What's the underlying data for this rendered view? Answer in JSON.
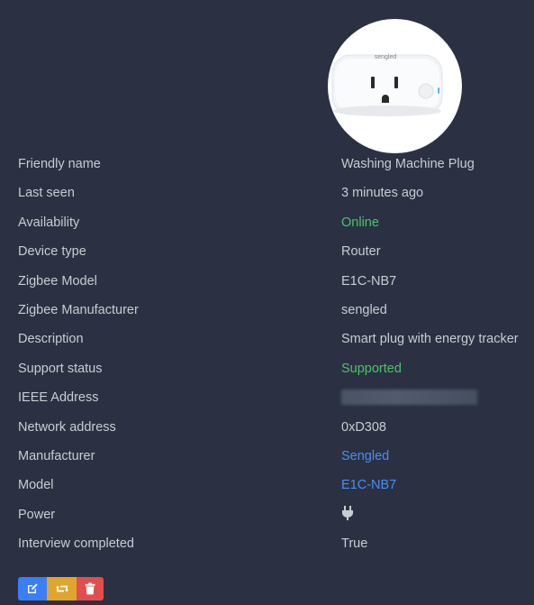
{
  "device": {
    "image_alt": "sengled",
    "rows": [
      {
        "label": "Friendly name",
        "value": "Washing Machine Plug"
      },
      {
        "label": "Last seen",
        "value": "3 minutes ago"
      },
      {
        "label": "Availability",
        "value": "Online"
      },
      {
        "label": "Device type",
        "value": "Router"
      },
      {
        "label": "Zigbee Model",
        "value": "E1C-NB7"
      },
      {
        "label": "Zigbee Manufacturer",
        "value": "sengled"
      },
      {
        "label": "Description",
        "value": "Smart plug with energy tracker"
      },
      {
        "label": "Support status",
        "value": "Supported"
      },
      {
        "label": "IEEE Address",
        "value": ""
      },
      {
        "label": "Network address",
        "value": "0xD308"
      },
      {
        "label": "Manufacturer",
        "value": "Sengled"
      },
      {
        "label": "Model",
        "value": "E1C-NB7"
      },
      {
        "label": "Power",
        "value": ""
      },
      {
        "label": "Interview completed",
        "value": "True"
      }
    ],
    "power_icon": "plug-icon"
  },
  "actions": {
    "edit_icon": "edit-icon",
    "reconfigure_icon": "reconfigure-icon",
    "delete_icon": "trash-icon"
  },
  "colors": {
    "background": "#2b3142",
    "text": "#c9ccd3",
    "success": "#4fc06f",
    "link": "#4a8ef5",
    "edit": "#3a7ff5",
    "reconfigure": "#e0a52c",
    "delete": "#e04e4e"
  }
}
